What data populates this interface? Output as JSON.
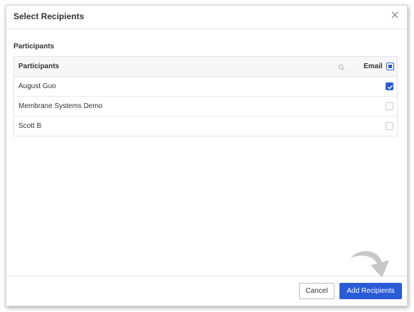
{
  "dialog": {
    "title": "Select Recipients",
    "close_icon": "close-icon"
  },
  "section": {
    "label": "Participants"
  },
  "table": {
    "header": {
      "participants": "Participants",
      "search_icon": "search-icon",
      "email": "Email",
      "select_all_state": "indeterminate"
    },
    "rows": [
      {
        "name": "August Guo",
        "email_checked": true
      },
      {
        "name": "Membrane Systems Demo",
        "email_checked": false
      },
      {
        "name": "Scott B",
        "email_checked": false
      }
    ]
  },
  "footer": {
    "cancel_label": "Cancel",
    "add_label": "Add Recipients"
  },
  "annotation": {
    "icon": "curved-arrow-icon"
  },
  "colors": {
    "accent": "#2a5bd7",
    "annotation_arrow": "#c8c8c8"
  }
}
